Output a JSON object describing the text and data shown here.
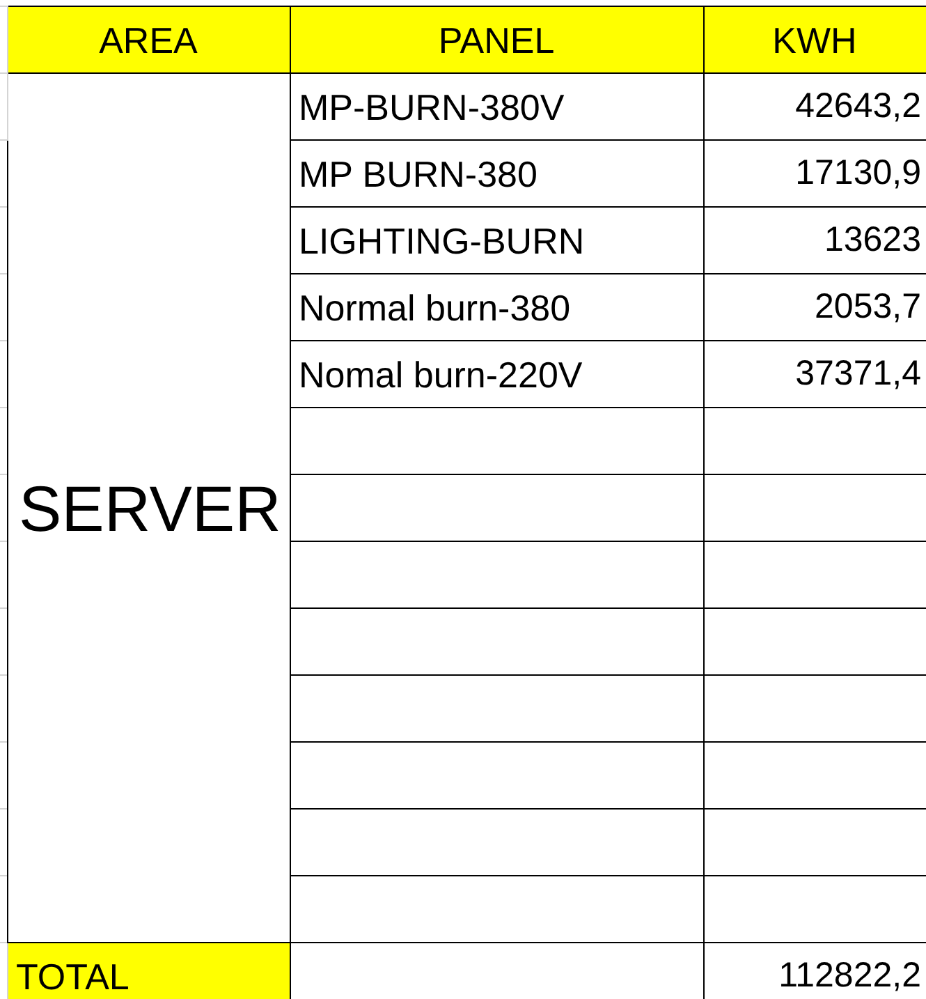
{
  "columns": [
    "AREA",
    "PANEL",
    "KWH"
  ],
  "area": "SERVER",
  "rows": [
    {
      "panel": "MP-BURN-380V",
      "kwh": "42643,2"
    },
    {
      "panel": "MP BURN-380",
      "kwh": "17130,9"
    },
    {
      "panel": "LIGHTING-BURN",
      "kwh": "13623"
    },
    {
      "panel": "Normal burn-380",
      "kwh": "2053,7"
    },
    {
      "panel": "Nomal burn-220V",
      "kwh": "37371,4"
    },
    {
      "panel": "",
      "kwh": ""
    },
    {
      "panel": "",
      "kwh": ""
    },
    {
      "panel": "",
      "kwh": ""
    },
    {
      "panel": "",
      "kwh": ""
    },
    {
      "panel": "",
      "kwh": ""
    },
    {
      "panel": "",
      "kwh": ""
    },
    {
      "panel": "",
      "kwh": ""
    },
    {
      "panel": "",
      "kwh": ""
    }
  ],
  "total": {
    "label": "TOTAL",
    "kwh": "112822,2"
  }
}
